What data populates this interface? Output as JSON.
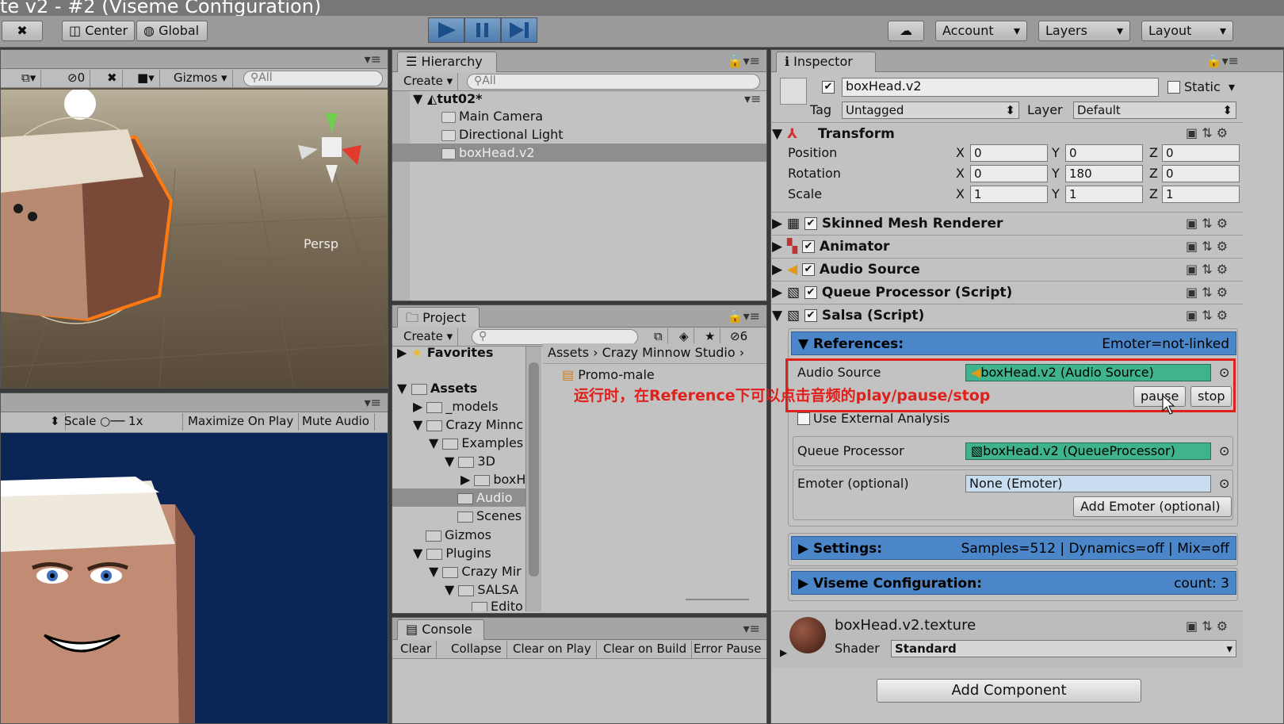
{
  "window": {
    "title": "te v2 - #2 (Viseme Configuration)"
  },
  "toolbar": {
    "center": "Center",
    "global": "Global",
    "account": "Account",
    "layers": "Layers",
    "layout": "Layout"
  },
  "scene": {
    "gizmos": "Gizmos",
    "search": "All",
    "hidden_count": "0",
    "persp": "Persp"
  },
  "game": {
    "scale_label": "Scale",
    "scale_value": "1x",
    "maximize": "Maximize On Play",
    "mute": "Mute Audio"
  },
  "hierarchy": {
    "tab": "Hierarchy",
    "create": "Create",
    "search": "All",
    "scene": "tut02*",
    "items": [
      "Main Camera",
      "Directional Light",
      "boxHead.v2"
    ]
  },
  "project": {
    "tab": "Project",
    "create": "Create",
    "hidden_count": "6",
    "favorites": "Favorites",
    "assets": "Assets",
    "tree": [
      "_models",
      "Crazy Minnc",
      "Examples",
      "3D",
      "boxH",
      "Audio",
      "Scenes",
      "Gizmos",
      "Plugins",
      "Crazy Mir",
      "SALSA",
      "Edito"
    ],
    "breadcrumb": [
      "Assets",
      "Crazy Minnow Studio"
    ],
    "file": "Promo-male"
  },
  "console": {
    "tab": "Console",
    "buttons": [
      "Clear",
      "Collapse",
      "Clear on Play",
      "Clear on Build",
      "Error Pause"
    ]
  },
  "inspector": {
    "tab": "Inspector",
    "name": "boxHead.v2",
    "static": "Static",
    "tag_label": "Tag",
    "tag": "Untagged",
    "layer_label": "Layer",
    "layer": "Default",
    "transform": {
      "title": "Transform",
      "position": "Position",
      "rotation": "Rotation",
      "scale": "Scale",
      "x": "X",
      "y": "Y",
      "z": "Z",
      "pos": [
        "0",
        "0",
        "0"
      ],
      "rot": [
        "0",
        "180",
        "0"
      ],
      "scl": [
        "1",
        "1",
        "1"
      ]
    },
    "components": [
      "Skinned Mesh Renderer",
      "Animator",
      "Audio Source",
      "Queue Processor (Script)",
      "Salsa (Script)"
    ],
    "references": {
      "title": "References:",
      "status": "Emoter=not-linked",
      "audio_label": "Audio Source",
      "audio_value": "boxHead.v2 (Audio Source)",
      "pause": "pause",
      "stop": "stop",
      "external": "Use External Analysis",
      "queue_label": "Queue Processor",
      "queue_value": "boxHead.v2 (QueueProcessor)",
      "emoter_label": "Emoter (optional)",
      "emoter_value": "None (Emoter)",
      "add_emoter": "Add Emoter (optional)"
    },
    "settings": {
      "title": "Settings:",
      "status": "Samples=512 | Dynamics=off | Mix=off"
    },
    "viseme": {
      "title": "Viseme Configuration:",
      "status": "count: 3"
    },
    "material": {
      "name": "boxHead.v2.texture",
      "shader_label": "Shader",
      "shader": "Standard"
    },
    "add_component": "Add Component"
  },
  "annotation": "运行时，在Reference下可以点击音频的play/pause/stop",
  "colors": {
    "accent": "#4a86c8",
    "object_field": "#3fb28e",
    "annotation": "#e0201a"
  }
}
